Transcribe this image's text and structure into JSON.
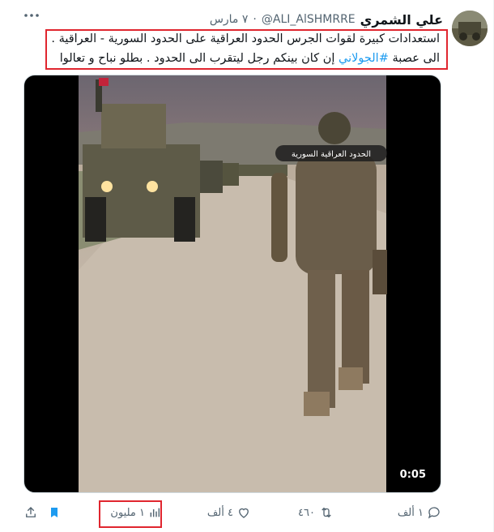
{
  "tweet": {
    "display_name": "علي الشمري",
    "handle": "@ALI_AlSHMRRE",
    "separator": "·",
    "date": "٧ مارس",
    "text_line1": "استعدادات كبيرة لقوات الجرس الحدود العراقية على الحدود السورية - العراقية .",
    "text_line2_pre": "الى عصبة ",
    "hashtag": "#الجولاني",
    "text_line2_post": " إن كان بينكم رجل ليتقرب الى الحدود . بطلو نباح و تعالوا"
  },
  "media": {
    "caption": "الحدود العراقية السورية",
    "duration": "0:05"
  },
  "actions": {
    "replies": "١ ألف",
    "reposts": "٤٦٠",
    "likes": "٤ ألف",
    "views": "١ مليون"
  },
  "colors": {
    "accent": "#1d9bf0",
    "highlight": "#e0262f",
    "muted": "#536471"
  },
  "icons": [
    "more-icon",
    "reply-icon",
    "repost-icon",
    "like-icon",
    "views-icon",
    "bookmark-icon",
    "share-icon"
  ]
}
